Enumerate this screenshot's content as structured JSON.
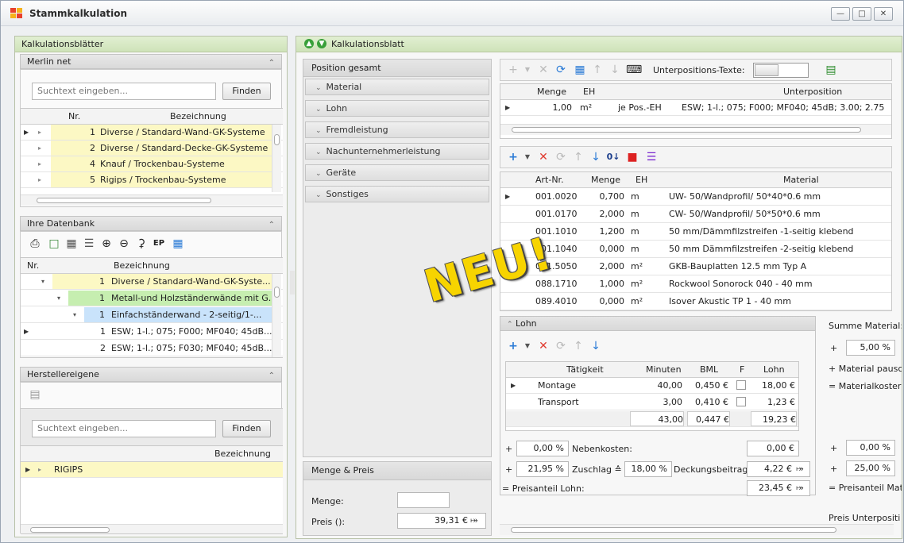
{
  "window": {
    "title": "Stammkalkulation"
  },
  "colors": {
    "header_green": "#cfe3b9",
    "yellow_row": "#fcf8c4",
    "green_row": "#c6eeb0",
    "blue_row": "#c9e3fb",
    "accent_blue": "#2b7bd6",
    "delete_red": "#e03c31"
  },
  "left": {
    "panel_title": "Kalkulationsblätter",
    "merlin": {
      "title": "Merlin net",
      "search_placeholder": "Suchtext eingeben...",
      "find_label": "Finden",
      "col_nr": "Nr.",
      "col_bez": "Bezeichnung",
      "rows": [
        {
          "nr": "1",
          "bez": "Diverse / Standard-Wand-GK-Systeme"
        },
        {
          "nr": "2",
          "bez": "Diverse / Standard-Decke-GK-Systeme"
        },
        {
          "nr": "4",
          "bez": "Knauf / Trockenbau-Systeme"
        },
        {
          "nr": "5",
          "bez": "Rigips / Trockenbau-Systeme"
        }
      ]
    },
    "datenbank": {
      "title": "Ihre Datenbank",
      "toolbar_ep": "EP",
      "col_nr": "Nr.",
      "col_bez": "Bezeichnung",
      "rows": [
        {
          "nr": "1",
          "bez": "Diverse / Standard-Wand-GK-Syste..."
        },
        {
          "nr": "1",
          "bez": "Metall-und Holzständerwände mit G..."
        },
        {
          "nr": "1",
          "bez": "Einfachständerwand     - 2-seitig/1-..."
        },
        {
          "nr": "1",
          "bez": "ESW; 1-l.; 075; F000; MF040; 45dB..."
        },
        {
          "nr": "2",
          "bez": "ESW; 1-l.; 075; F030; MF040; 45dB..."
        }
      ]
    },
    "hersteller": {
      "title": "Herstellereigene",
      "search_placeholder": "Suchtext eingeben...",
      "find_label": "Finden",
      "col_bez": "Bezeichnung",
      "rows": [
        {
          "bez": "RIGIPS"
        }
      ]
    }
  },
  "main": {
    "title": "Kalkulationsblatt",
    "position_gesamt": "Position gesamt",
    "sections": [
      "Material",
      "Lohn",
      "Fremdleistung",
      "Nachunternehmerleistung",
      "Geräte",
      "Sonstiges"
    ],
    "menge_preis": {
      "title": "Menge & Preis",
      "menge_label": "Menge:",
      "menge_value": "",
      "preis_label": "Preis ():",
      "preis_value": "39,31 €"
    },
    "unterposition": {
      "toolbar_label": "Unterpositions-Texte:",
      "col_menge": "Menge",
      "col_eh": "EH",
      "col_unterposition": "Unterposition",
      "row": {
        "menge": "1,00",
        "eh": "m²",
        "basis": "je Pos.-EH",
        "text": "ESW; 1-l.; 075; F000; MF040; 45dB; 3.00; 2.75"
      }
    },
    "material": {
      "col_artnr": "Art-Nr.",
      "col_menge": "Menge",
      "col_eh": "EH",
      "col_material": "Material",
      "rows": [
        {
          "artnr": "001.0020",
          "menge": "0,700",
          "eh": "m",
          "material": "UW- 50/Wandprofil/ 50*40*0.6 mm"
        },
        {
          "artnr": "001.0170",
          "menge": "2,000",
          "eh": "m",
          "material": "CW- 50/Wandprofil/ 50*50*0.6 mm"
        },
        {
          "artnr": "001.1010",
          "menge": "1,200",
          "eh": "m",
          "material": "50 mm/Dämmfilzstreifen  -1-seitig klebend"
        },
        {
          "artnr": "001.1040",
          "menge": "0,000",
          "eh": "m",
          "material": "50 mm Dämmfilzstreifen  -2-seitig klebend"
        },
        {
          "artnr": "001.5050",
          "menge": "2,000",
          "eh": "m²",
          "material": "GKB-Bauplatten 12.5 mm Typ A"
        },
        {
          "artnr": "088.1710",
          "menge": "1,000",
          "eh": "m²",
          "material": "Rockwool Sonorock 040              - 40 mm"
        },
        {
          "artnr": "089.4010",
          "menge": "0,000",
          "eh": "m²",
          "material": "Isover Akustic TP 1              - 40 mm"
        }
      ]
    },
    "lohn": {
      "title": "Lohn",
      "col_taetigkeit": "Tätigkeit",
      "col_minuten": "Minuten",
      "col_bml": "BML",
      "col_f": "F",
      "col_lohn": "Lohn",
      "rows": [
        {
          "taetigkeit": "Montage",
          "minuten": "40,00",
          "bml": "0,450 €",
          "lohn": "18,00 €"
        },
        {
          "taetigkeit": "Transport",
          "minuten": "3,00",
          "bml": "0,410 €",
          "lohn": "1,23 €"
        }
      ],
      "total": {
        "minuten": "43,00",
        "bml": "0,447 €",
        "lohn": "19,23 €"
      },
      "nebenkosten": {
        "sign": "+",
        "pct": "0,00 %",
        "label": "Nebenkosten:",
        "value": "0,00 €"
      },
      "zuschlag": {
        "sign": "+",
        "pct": "21,95 %",
        "label": "Zuschlag ≙",
        "pct2": "18,00 %",
        "label2": "Deckungsbeitrag:",
        "value": "4,22 €"
      },
      "preisanteil": {
        "label": "= Preisanteil Lohn:",
        "value": "23,45 €"
      }
    },
    "summary": {
      "summe_material": "Summe Material:",
      "sign1": "+",
      "pct1": "5,00 %",
      "material_pausch": "+ Material pausc",
      "materialkosten": "= Materialkoster",
      "sign2": "+",
      "pct2": "0,00 %",
      "sign3": "+",
      "pct3": "25,00 %",
      "preisanteil_mat": "= Preisanteil Mat",
      "preis_unterpos": "Preis Unterpositi"
    },
    "banner": "NEU!"
  }
}
